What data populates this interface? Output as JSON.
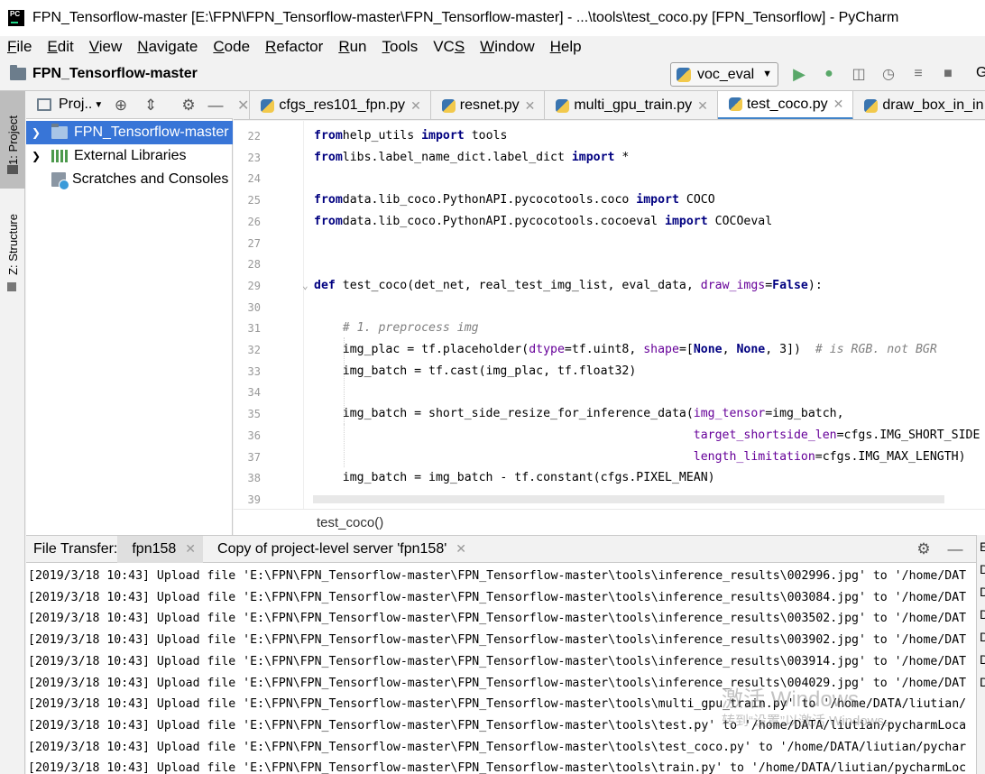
{
  "window": {
    "title": "FPN_Tensorflow-master [E:\\FPN\\FPN_Tensorflow-master\\FPN_Tensorflow-master] - ...\\tools\\test_coco.py [FPN_Tensorflow] - PyCharm",
    "logo_text": "PC"
  },
  "menu": [
    {
      "ul": "F",
      "rest": "ile"
    },
    {
      "ul": "E",
      "rest": "dit"
    },
    {
      "ul": "V",
      "rest": "iew"
    },
    {
      "ul": "N",
      "rest": "avigate"
    },
    {
      "ul": "C",
      "rest": "ode"
    },
    {
      "ul": "R",
      "rest": "efactor"
    },
    {
      "ul": "R",
      "rest": "un"
    },
    {
      "ul": "T",
      "rest": "ools"
    },
    {
      "ul": "",
      "rest": "VCS",
      "ul_at": "S"
    },
    {
      "ul": "W",
      "rest": "indow"
    },
    {
      "ul": "H",
      "rest": "elp"
    }
  ],
  "navbar": {
    "project": "FPN_Tensorflow-master",
    "run_config": "voc_eval",
    "trailing_label": "G"
  },
  "sidebar_left": {
    "project_tab": "1: Project",
    "structure_tab": "Z: Structure"
  },
  "project_panel": {
    "title": "Proj..",
    "tree": [
      {
        "label": "FPN_Tensorflow-master",
        "selected": true
      },
      {
        "label": "External Libraries",
        "selected": false
      },
      {
        "label": "Scratches and Consoles",
        "selected": false
      }
    ]
  },
  "editor_tabs": [
    {
      "label": "cfgs_res101_fpn.py",
      "active": false
    },
    {
      "label": "resnet.py",
      "active": false
    },
    {
      "label": "multi_gpu_train.py",
      "active": false
    },
    {
      "label": "test_coco.py",
      "active": true
    },
    {
      "label": "draw_box_in_in",
      "active": false
    }
  ],
  "breadcrumb": "test_coco()",
  "bottom_panel": {
    "label": "File Transfer:",
    "tabs": [
      {
        "label": "fpn158",
        "active": true
      },
      {
        "label": "Copy of project-level server 'fpn158'",
        "active": false
      }
    ],
    "right_strip_letters": [
      "E",
      "D",
      "D",
      "D",
      "D",
      "D",
      "D"
    ],
    "log": [
      "[2019/3/18 10:43] Upload file 'E:\\FPN\\FPN_Tensorflow-master\\FPN_Tensorflow-master\\tools\\inference_results\\002996.jpg' to '/home/DAT",
      "[2019/3/18 10:43] Upload file 'E:\\FPN\\FPN_Tensorflow-master\\FPN_Tensorflow-master\\tools\\inference_results\\003084.jpg' to '/home/DAT",
      "[2019/3/18 10:43] Upload file 'E:\\FPN\\FPN_Tensorflow-master\\FPN_Tensorflow-master\\tools\\inference_results\\003502.jpg' to '/home/DAT",
      "[2019/3/18 10:43] Upload file 'E:\\FPN\\FPN_Tensorflow-master\\FPN_Tensorflow-master\\tools\\inference_results\\003902.jpg' to '/home/DAT",
      "[2019/3/18 10:43] Upload file 'E:\\FPN\\FPN_Tensorflow-master\\FPN_Tensorflow-master\\tools\\inference_results\\003914.jpg' to '/home/DAT",
      "[2019/3/18 10:43] Upload file 'E:\\FPN\\FPN_Tensorflow-master\\FPN_Tensorflow-master\\tools\\inference_results\\004029.jpg' to '/home/DAT",
      "[2019/3/18 10:43] Upload file 'E:\\FPN\\FPN_Tensorflow-master\\FPN_Tensorflow-master\\tools\\multi_gpu_train.py' to '/home/DATA/liutian/",
      "[2019/3/18 10:43] Upload file 'E:\\FPN\\FPN_Tensorflow-master\\FPN_Tensorflow-master\\tools\\test.py' to '/home/DATA/liutian/pycharmLoca",
      "[2019/3/18 10:43] Upload file 'E:\\FPN\\FPN_Tensorflow-master\\FPN_Tensorflow-master\\tools\\test_coco.py' to '/home/DATA/liutian/pychar",
      "[2019/3/18 10:43] Upload file 'E:\\FPN\\FPN_Tensorflow-master\\FPN_Tensorflow-master\\tools\\train.py' to '/home/DATA/liutian/pycharmLoc"
    ]
  },
  "code_lines": [
    {
      "n": "22",
      "segs": [
        [
          "kw",
          "from"
        ],
        [
          "",
          "help_utils "
        ],
        [
          "kw",
          "import"
        ],
        [
          "",
          " tools"
        ]
      ]
    },
    {
      "n": "23",
      "segs": [
        [
          "kw",
          "from"
        ],
        [
          "",
          "libs.label_name_dict.label_dict "
        ],
        [
          "kw",
          "import"
        ],
        [
          "",
          " *"
        ]
      ]
    },
    {
      "n": "24",
      "segs": []
    },
    {
      "n": "25",
      "segs": [
        [
          "kw",
          "from"
        ],
        [
          "",
          "data.lib_coco.PythonAPI.pycocotools.coco "
        ],
        [
          "kw",
          "import"
        ],
        [
          "",
          " COCO"
        ]
      ]
    },
    {
      "n": "26",
      "segs": [
        [
          "kw",
          "from"
        ],
        [
          "",
          "data.lib_coco.PythonAPI.pycocotools.cocoeval "
        ],
        [
          "kw",
          "import"
        ],
        [
          "",
          " COCOeval"
        ]
      ]
    },
    {
      "n": "27",
      "segs": []
    },
    {
      "n": "28",
      "segs": []
    },
    {
      "n": "29",
      "segs": [
        [
          "kw",
          "def"
        ],
        [
          "",
          " test_coco(det_net, real_test_img_list, eval_data, "
        ],
        [
          "kwarg",
          "draw_imgs"
        ],
        [
          "",
          "="
        ],
        [
          "kw",
          "False"
        ],
        [
          "",
          "):"
        ]
      ]
    },
    {
      "n": "30",
      "segs": []
    },
    {
      "n": "31",
      "segs": [
        [
          "",
          "    "
        ],
        [
          "cmt",
          "# 1. preprocess img"
        ]
      ]
    },
    {
      "n": "32",
      "segs": [
        [
          "",
          "    img_plac = tf.placeholder("
        ],
        [
          "kwarg",
          "dtype"
        ],
        [
          "",
          "=tf.uint8, "
        ],
        [
          "kwarg",
          "shape"
        ],
        [
          "",
          "=["
        ],
        [
          "kw",
          "None"
        ],
        [
          "",
          ", "
        ],
        [
          "kw",
          "None"
        ],
        [
          "",
          ", 3])  "
        ],
        [
          "cmt",
          "# is RGB. not BGR"
        ]
      ]
    },
    {
      "n": "33",
      "segs": [
        [
          "",
          "    img_batch = tf.cast(img_plac, tf.float32)"
        ]
      ]
    },
    {
      "n": "34",
      "segs": []
    },
    {
      "n": "35",
      "segs": [
        [
          "",
          "    img_batch = short_side_resize_for_inference_data("
        ],
        [
          "kwarg",
          "img_tensor"
        ],
        [
          "",
          "=img_batch,"
        ]
      ]
    },
    {
      "n": "36",
      "segs": [
        [
          "",
          "                                                     "
        ],
        [
          "kwarg",
          "target_shortside_len"
        ],
        [
          "",
          "=cfgs.IMG_SHORT_SIDE"
        ]
      ]
    },
    {
      "n": "37",
      "segs": [
        [
          "",
          "                                                     "
        ],
        [
          "kwarg",
          "length_limitation"
        ],
        [
          "",
          "=cfgs.IMG_MAX_LENGTH)"
        ]
      ]
    },
    {
      "n": "38",
      "segs": [
        [
          "",
          "    img_batch = img_batch - tf.constant(cfgs.PIXEL_MEAN)"
        ]
      ]
    },
    {
      "n": "39",
      "segs": []
    }
  ],
  "watermark": {
    "line1": "激活 Windows",
    "line2": "转到“设置”以激活 Windows。"
  }
}
